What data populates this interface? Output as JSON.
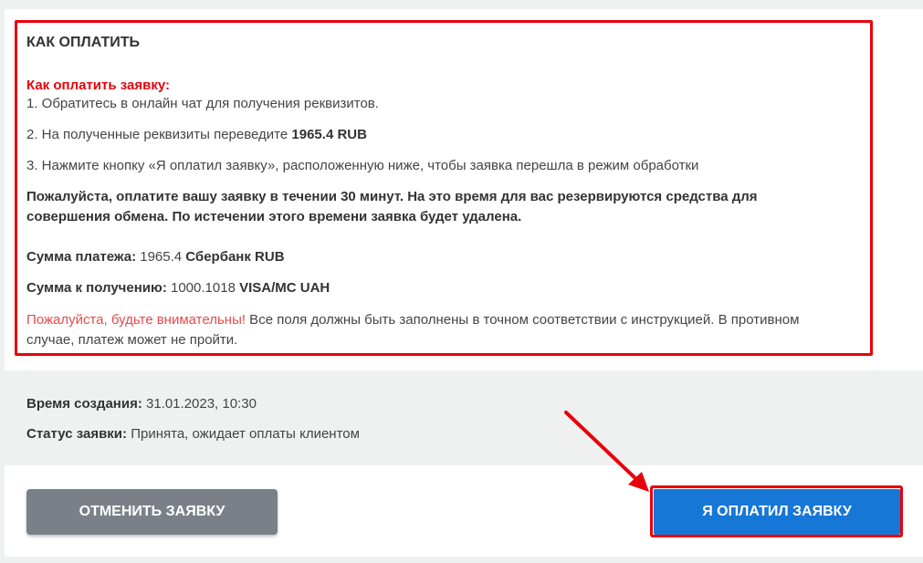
{
  "instructions": {
    "title": "КАК ОПЛАТИТЬ",
    "how_to_heading": "Как оплатить заявку:",
    "step1": "1. Обратитесь в онлайн чат для получения реквизитов.",
    "step2_prefix": "2. На полученные реквизиты переведите ",
    "step2_amount": "1965.4 RUB",
    "step3": "3. Нажмите кнопку «Я оплатил заявку», расположенную ниже, чтобы заявка перешла в режим обработки",
    "notice_line1": "Пожалуйста, оплатите вашу заявку в течении 30 минут. На это время для вас резервируются средства для",
    "notice_line2": "совершения обмена. По истечении этого времени заявка будет удалена.",
    "payment_sum_label": "Сумма платежа:",
    "payment_sum_value": "1965.4",
    "payment_sum_method": "Сбербанк RUB",
    "receive_sum_label": "Сумма к получению:",
    "receive_sum_value": "1000.1018",
    "receive_sum_method": "VISA/MC UAH",
    "warning_red": "Пожалуйста, будьте внимательны!",
    "warning_rest_line1": " Все поля должны быть заполнены в точном соответствии с инструкцией. В противном",
    "warning_line2": "случае, платеж может не пройти."
  },
  "order_info": {
    "created_label": "Время создания:",
    "created_value": "31.01.2023, 10:30",
    "status_label": "Статус заявки:",
    "status_value": "Принята, ожидает оплаты клиентом"
  },
  "actions": {
    "cancel_label": "ОТМЕНИТЬ ЗАЯВКУ",
    "paid_label": "Я ОПЛАТИЛ ЗАЯВКУ"
  },
  "colors": {
    "highlight": "#e8000b",
    "primary_button": "#1677d6",
    "cancel_button": "#7b8088"
  }
}
